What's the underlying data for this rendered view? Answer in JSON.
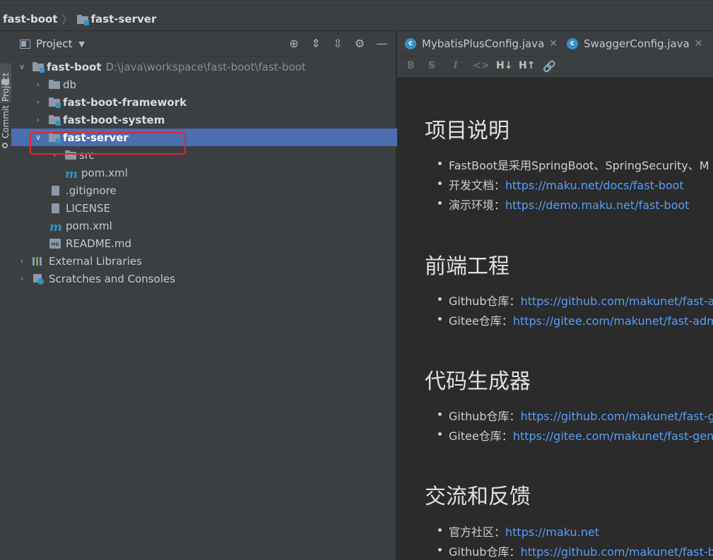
{
  "breadcrumb": {
    "root": "fast-boot",
    "module": "fast-server"
  },
  "side_tabs": {
    "project": "Project",
    "commit": "Commit"
  },
  "project_panel": {
    "title": "Project",
    "tools": [
      "locate-icon",
      "expand-all-icon",
      "collapse-all-icon",
      "gear-icon",
      "minimize-icon"
    ]
  },
  "tree": {
    "root_name": "fast-boot",
    "root_path": "D:\\java\\workspace\\fast-boot\\fast-boot",
    "items": [
      {
        "name": "db"
      },
      {
        "name": "fast-boot-framework"
      },
      {
        "name": "fast-boot-system"
      },
      {
        "name": "fast-server"
      },
      {
        "name": "src"
      },
      {
        "name": "pom.xml"
      },
      {
        "name": ".gitignore"
      },
      {
        "name": "LICENSE"
      },
      {
        "name": "pom.xml"
      },
      {
        "name": "README.md"
      },
      {
        "name": "External Libraries"
      },
      {
        "name": "Scratches and Consoles"
      }
    ]
  },
  "editor_tabs": [
    {
      "label": "MybatisPlusConfig.java"
    },
    {
      "label": "SwaggerConfig.java"
    }
  ],
  "markdown_toolbar": [
    "B",
    "S",
    "I",
    "<>",
    "H↓",
    "H↑",
    "link"
  ],
  "doc": {
    "sections": [
      {
        "heading": "项目说明",
        "items": [
          {
            "text": "FastBoot是采用SpringBoot、SpringSecurity、M",
            "link": ""
          },
          {
            "text": "开发文档：",
            "link": "https://maku.net/docs/fast-boot"
          },
          {
            "text": "演示环境：",
            "link": "https://demo.maku.net/fast-boot"
          }
        ]
      },
      {
        "heading": "前端工程",
        "items": [
          {
            "text": "Github仓库：",
            "link": "https://github.com/makunet/fast-ad"
          },
          {
            "text": "Gitee仓库：",
            "link": "https://gitee.com/makunet/fast-admi"
          }
        ]
      },
      {
        "heading": "代码生成器",
        "items": [
          {
            "text": "Github仓库：",
            "link": "https://github.com/makunet/fast-ge"
          },
          {
            "text": "Gitee仓库：",
            "link": "https://gitee.com/makunet/fast-gene"
          }
        ]
      },
      {
        "heading": "交流和反馈",
        "items": [
          {
            "text": "官方社区：",
            "link": "https://maku.net"
          },
          {
            "text": "Github仓库：",
            "link": "https://github.com/makunet/fast-bo"
          }
        ]
      }
    ]
  },
  "colors": {
    "selection": "#4b6eaf",
    "highlight_box": "#e3262e",
    "link": "#589df6",
    "accent": "#3592c4"
  }
}
